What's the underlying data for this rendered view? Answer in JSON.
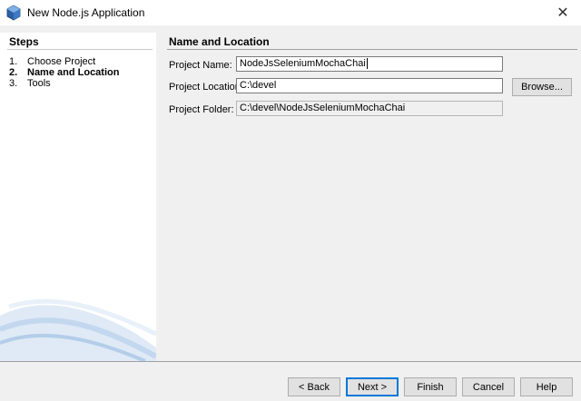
{
  "window": {
    "title": "New Node.js Application",
    "app_icon": "netbeans-cube-icon",
    "close_label": "✕"
  },
  "steps": {
    "title": "Steps",
    "items": [
      {
        "number": "1.",
        "label": "Choose Project",
        "current": false
      },
      {
        "number": "2.",
        "label": "Name and Location",
        "current": true
      },
      {
        "number": "3.",
        "label": "Tools",
        "current": false
      }
    ]
  },
  "panel": {
    "title": "Name and Location",
    "project_name": {
      "label": "Project Name:",
      "value": "NodeJsSeleniumMochaChai"
    },
    "project_location": {
      "label": "Project Location:",
      "value": "C:\\devel"
    },
    "project_folder": {
      "label": "Project Folder:",
      "value": "C:\\devel\\NodeJsSeleniumMochaChai"
    },
    "browse_label": "Browse..."
  },
  "buttons": {
    "back": "< Back",
    "next": "Next >",
    "finish": "Finish",
    "cancel": "Cancel",
    "help": "Help"
  }
}
